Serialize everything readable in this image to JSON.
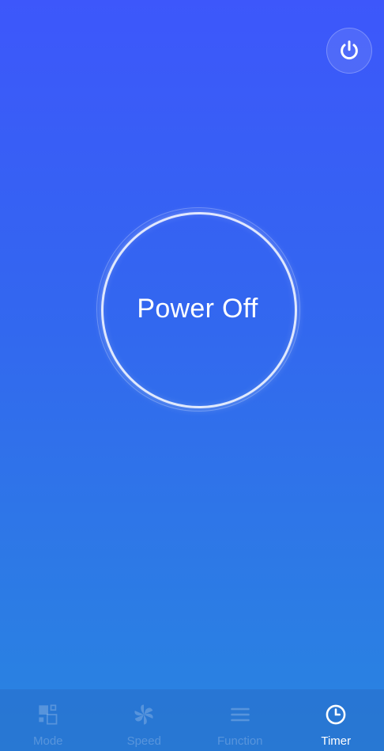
{
  "dial": {
    "status_label": "Power Off"
  },
  "top_bar": {
    "power_icon": "power-icon"
  },
  "tabs": [
    {
      "label": "Mode",
      "icon": "mode-grid-icon",
      "active": false
    },
    {
      "label": "Speed",
      "icon": "fan-icon",
      "active": false
    },
    {
      "label": "Function",
      "icon": "menu-lines-icon",
      "active": false
    },
    {
      "label": "Timer",
      "icon": "clock-icon",
      "active": true
    }
  ],
  "colors": {
    "background_top": "#3d57fb",
    "background_bottom": "#2885e0",
    "text": "#ffffff"
  }
}
